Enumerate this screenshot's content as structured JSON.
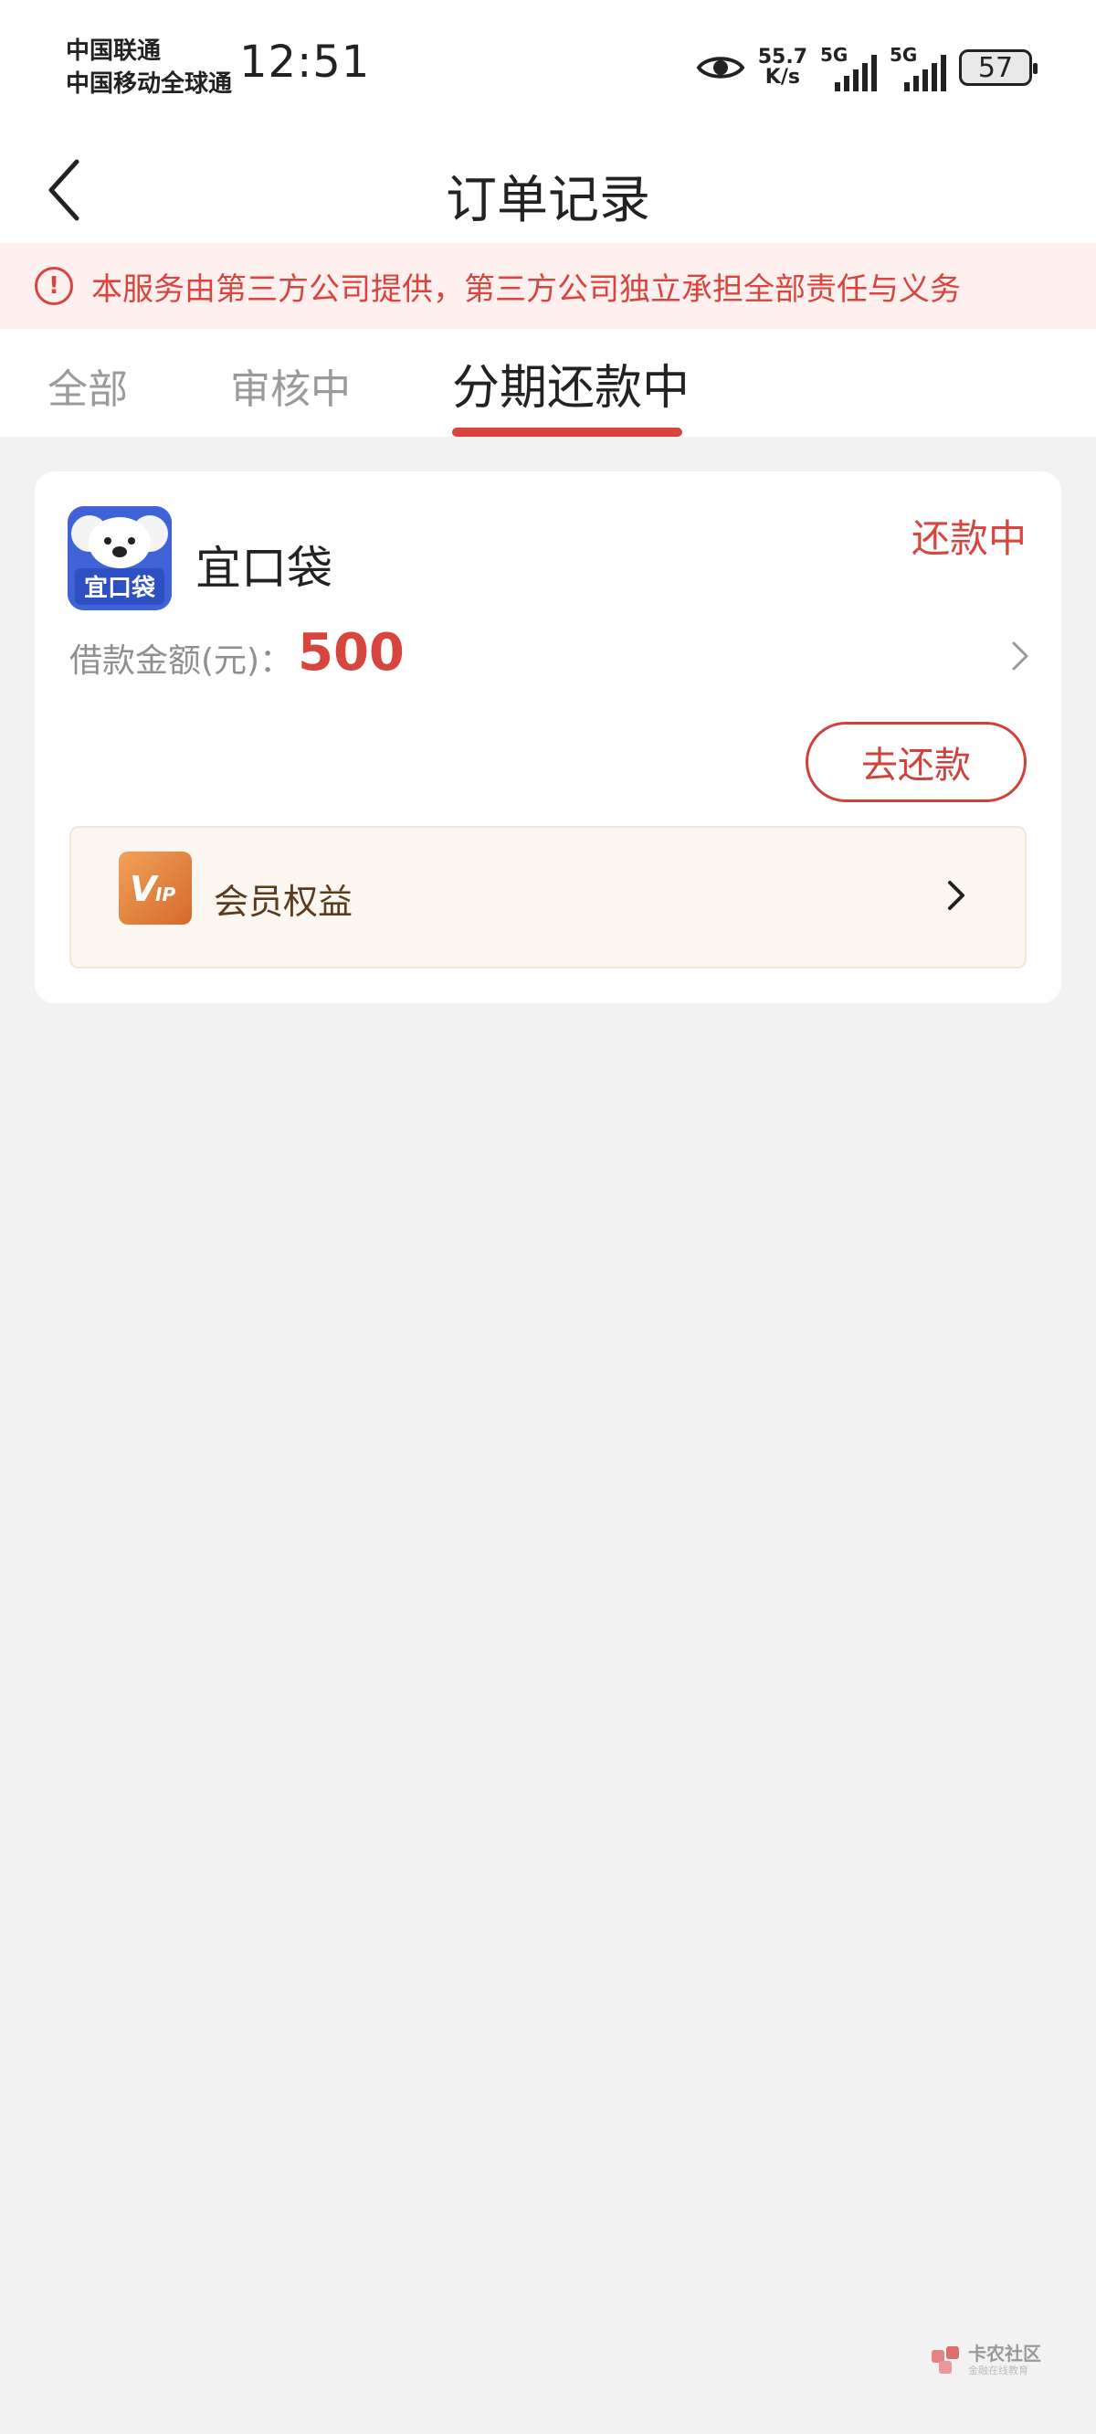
{
  "status_bar": {
    "carrier_1": "中国联通",
    "carrier_2": "中国移动全球通",
    "time": "12:51",
    "speed_value": "55.7",
    "speed_unit": "K/s",
    "net_1": "5G",
    "net_2": "5G",
    "battery": "57"
  },
  "header": {
    "title": "订单记录"
  },
  "notice": {
    "text": "本服务由第三方公司提供，第三方公司独立承担全部责任与义务",
    "color": "#d8453f"
  },
  "tabs": [
    {
      "label": "全部",
      "active": false
    },
    {
      "label": "审核中",
      "active": false
    },
    {
      "label": "分期还款中",
      "active": true
    }
  ],
  "order": {
    "app_name": "宜口袋",
    "logo_text": "宜口袋",
    "status": "还款中",
    "amount_label": "借款金额(元)：",
    "amount": "500",
    "repay_button": "去还款",
    "vip_label": "会员权益",
    "vip_icon_text": "VIP"
  },
  "watermark": {
    "text": "卡农社区",
    "sub": "金融在线教育"
  },
  "colors": {
    "accent_red": "#d8453f",
    "background": "#f2f2f2",
    "logo_blue": "#3f63d6",
    "vip_orange": "#e07a3a"
  }
}
